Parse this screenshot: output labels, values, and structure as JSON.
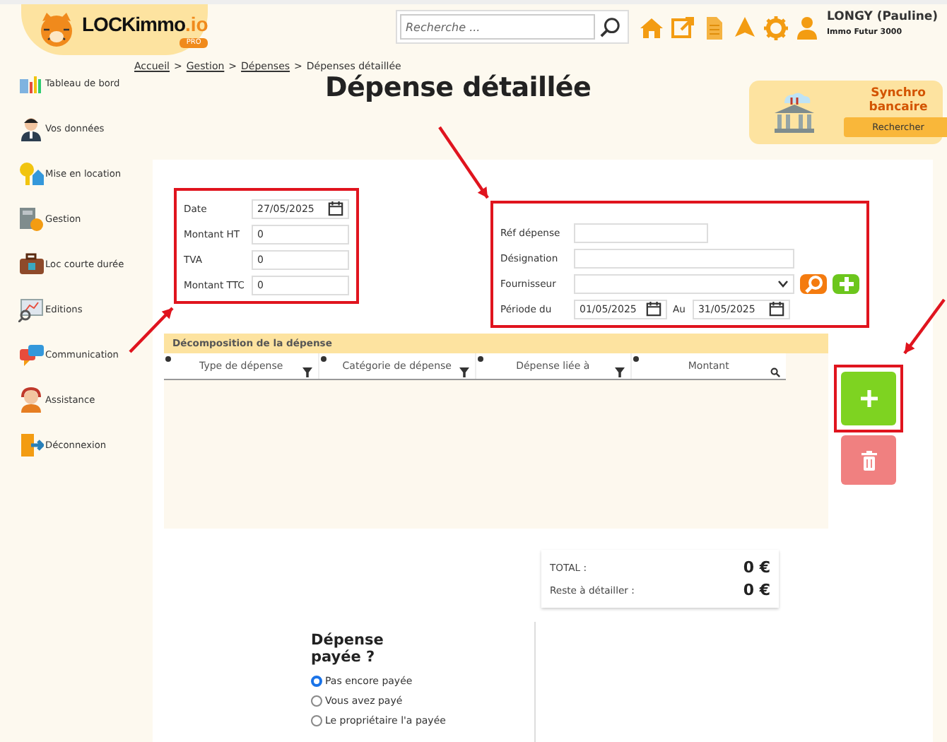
{
  "logo": {
    "text": "LOCKimmo",
    "suffix": ".io",
    "badge": "PRO"
  },
  "search": {
    "placeholder": "Recherche ..."
  },
  "toolbar_icons": [
    {
      "kind": "home"
    },
    {
      "kind": "external"
    },
    {
      "kind": "document"
    },
    {
      "kind": "bell"
    },
    {
      "kind": "settings"
    },
    {
      "kind": "user"
    }
  ],
  "user": {
    "name": "LONGY (Pauline)",
    "agency": "Immo Futur 3000"
  },
  "sidebar": {
    "items": [
      {
        "label": "Tableau de bord"
      },
      {
        "label": "Vos données"
      },
      {
        "label": "Mise en location"
      },
      {
        "label": "Gestion"
      },
      {
        "label": "Loc courte durée"
      },
      {
        "label": "Editions"
      },
      {
        "label": "Communication"
      },
      {
        "label": "Assistance"
      },
      {
        "label": "Déconnexion"
      }
    ]
  },
  "breadcrumb": {
    "separator": ">",
    "items": [
      {
        "label": "Accueil",
        "link": true
      },
      {
        "label": "Gestion",
        "link": true
      },
      {
        "label": "Dépenses",
        "link": true
      },
      {
        "label": "Dépenses détaillée",
        "link": false
      }
    ]
  },
  "title": "Dépense détaillée",
  "sync_card": {
    "title": "Synchro bancaire",
    "button": "Rechercher"
  },
  "amounts_form": {
    "highlighted": true,
    "fields": [
      {
        "label": "Date",
        "kind": "date",
        "value": "27/05/2025"
      },
      {
        "label": "Montant HT",
        "kind": "text",
        "value": "0"
      },
      {
        "label": "TVA",
        "kind": "text",
        "value": "0"
      },
      {
        "label": "Montant TTC",
        "kind": "text",
        "value": "0"
      }
    ]
  },
  "expense_form": {
    "highlighted": true,
    "fields": [
      {
        "label": "Réf dépense",
        "kind": "short"
      },
      {
        "label": "Désignation",
        "kind": "text"
      },
      {
        "label": "Fournisseur",
        "kind": "select"
      },
      {
        "label": "Période du",
        "kind": "range",
        "value": "01/05/2025",
        "to_label": "Au",
        "to_value": "31/05/2025"
      }
    ]
  },
  "breakdown": {
    "title": "Décomposition de la dépense",
    "columns": [
      {
        "label": "Type de dépense",
        "kind": "filter"
      },
      {
        "label": "Catégorie de dépense",
        "kind": "filter"
      },
      {
        "label": "Dépense liée à",
        "kind": "filter"
      },
      {
        "label": "Montant",
        "kind": "search"
      }
    ]
  },
  "actions": {
    "add_highlighted": true
  },
  "totals": [
    {
      "label": "TOTAL :",
      "value": "0 €"
    },
    {
      "label": "Reste à détailler :",
      "value": "0 €"
    }
  ],
  "payment": {
    "title": "Dépense payée ?",
    "options": [
      {
        "label": "Pas encore payée",
        "selected": true
      },
      {
        "label": "Vous avez payé",
        "selected": false
      },
      {
        "label": "Le propriétaire l'a payée",
        "selected": false
      }
    ]
  }
}
